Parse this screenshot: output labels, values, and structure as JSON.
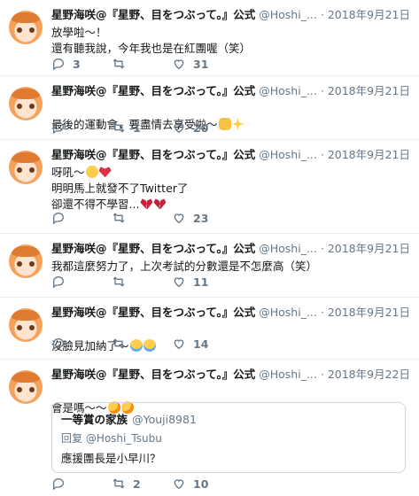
{
  "tweets": [
    {
      "name": "星野海咲@『星野、目をつぶって。』公式",
      "handle": "@Hoshi_...",
      "sep": "·",
      "date": "2018年9月21日",
      "text": "放學啦～！\n還有聽我說，今年我也是在紅團喔（笑）",
      "emojis": [],
      "replies": "3",
      "retweets": "",
      "likes": "31"
    },
    {
      "name": "星野海咲@『星野、目をつぶって。』公式",
      "handle": "@Hoshi_...",
      "sep": "·",
      "date": "2018年9月21日",
      "text": "最後的運動會，要盡情去享受啦～",
      "emojis": [
        "fist-emoji",
        "sparkles-emoji"
      ],
      "replies": "",
      "retweets": "1",
      "likes": "20"
    },
    {
      "name": "星野海咲@『星野、目をつぶって。』公式",
      "handle": "@Hoshi_...",
      "sep": "·",
      "date": "2018年9月21日",
      "text": "呀吼～",
      "text2": "明明馬上就發不了Twitter了",
      "text3": "卻還不得不學習...",
      "emojis": [
        "heart-eyes-emoji",
        "red-heart-emoji"
      ],
      "emojis3": [
        "broken-heart-emoji",
        "broken-heart-emoji"
      ],
      "replies": "",
      "retweets": "",
      "likes": "23"
    },
    {
      "name": "星野海咲@『星野、目をつぶって。』公式",
      "handle": "@Hoshi_...",
      "sep": "·",
      "date": "2018年9月21日",
      "text": "我都這麼努力了，上次考試的分數還是不怎麼高（笑）",
      "emojis": [],
      "replies": "",
      "retweets": "",
      "likes": "11"
    },
    {
      "name": "星野海咲@『星野、目をつぶって。』公式",
      "handle": "@Hoshi_...",
      "sep": "·",
      "date": "2018年9月21日",
      "text": "沒臉見加納了～",
      "emojis": [
        "tears-of-joy-emoji",
        "tears-of-joy-emoji"
      ],
      "replies": "",
      "retweets": "",
      "likes": "14"
    },
    {
      "name": "星野海咲@『星野、目をつぶって。』公式",
      "handle": "@Hoshi_...",
      "sep": "·",
      "date": "2018年9月22日",
      "text": "會是嗎～～",
      "emojis": [
        "thinking-emoji",
        "thinking-emoji"
      ],
      "quote": {
        "name": "一等賞の家族",
        "handle": "@Youji8981",
        "reply_to": "回复 @Hoshi_Tsubu",
        "text": "應援團長是小早川？"
      },
      "replies": "",
      "retweets": "2",
      "likes": "10"
    }
  ],
  "colors": {
    "text": "#14171a",
    "muted": "#657786",
    "border": "#e6ecf0"
  }
}
